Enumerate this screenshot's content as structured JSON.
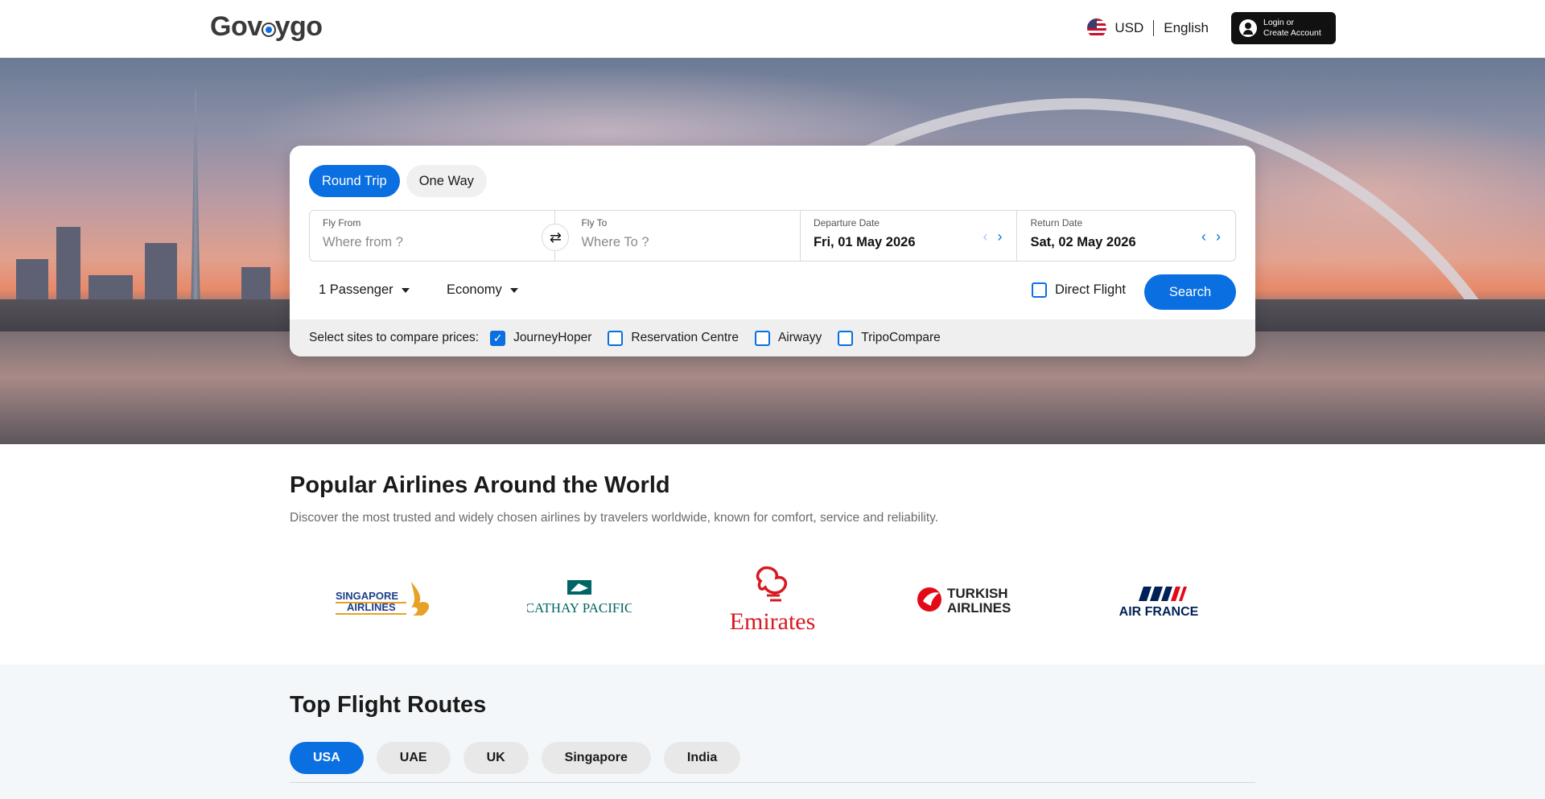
{
  "header": {
    "logo": "Govoygo",
    "currency": "USD",
    "language": "English",
    "login_line1": "Login or",
    "login_line2": "Create Account"
  },
  "search": {
    "tabs": [
      {
        "label": "Round Trip",
        "active": true
      },
      {
        "label": "One Way",
        "active": false
      }
    ],
    "fly_from_label": "Fly From",
    "fly_from_placeholder": "Where from ?",
    "fly_to_label": "Fly To",
    "fly_to_placeholder": "Where To ?",
    "departure_label": "Departure Date",
    "departure_value": "Fri, 01 May 2026",
    "return_label": "Return Date",
    "return_value": "Sat, 02 May 2026",
    "passengers": "1 Passenger",
    "cabin": "Economy",
    "direct_flight": "Direct Flight",
    "direct_flight_checked": false,
    "search_button": "Search",
    "compare_label": "Select sites to compare prices:",
    "compare_sites": [
      {
        "label": "JourneyHoper",
        "checked": true
      },
      {
        "label": "Reservation Centre",
        "checked": false
      },
      {
        "label": "Airwayy",
        "checked": false
      },
      {
        "label": "TripoCompare",
        "checked": false
      }
    ]
  },
  "airlines_section": {
    "title": "Popular Airlines Around the World",
    "subtitle": "Discover the most trusted and widely chosen airlines by travelers worldwide, known for comfort, service and reliability.",
    "logos": [
      {
        "line1": "SINGAPORE",
        "line2": "AIRLINES"
      },
      {
        "line1": "CATHAY PACIFIC"
      },
      {
        "line1": "Emirates"
      },
      {
        "line1": "TURKISH",
        "line2": "AIRLINES"
      },
      {
        "line1": "AIR FRANCE"
      }
    ]
  },
  "routes_section": {
    "title": "Top Flight Routes",
    "tabs": [
      {
        "label": "USA",
        "active": true
      },
      {
        "label": "UAE",
        "active": false
      },
      {
        "label": "UK",
        "active": false
      },
      {
        "label": "Singapore",
        "active": false
      },
      {
        "label": "India",
        "active": false
      }
    ]
  },
  "colors": {
    "primary": "#0a6fe0",
    "dark": "#111111",
    "singapore_gold": "#e6a227",
    "singapore_navy": "#1c3f8a",
    "cathay_green": "#006564",
    "emirates_red": "#d71921",
    "turkish_red": "#e30a17",
    "airfrance_navy": "#002157"
  },
  "icons": {
    "swap": "swap-arrows-icon",
    "prev": "chevron-left-icon",
    "next": "chevron-right-icon",
    "user": "user-icon",
    "flag": "us-flag-icon"
  }
}
